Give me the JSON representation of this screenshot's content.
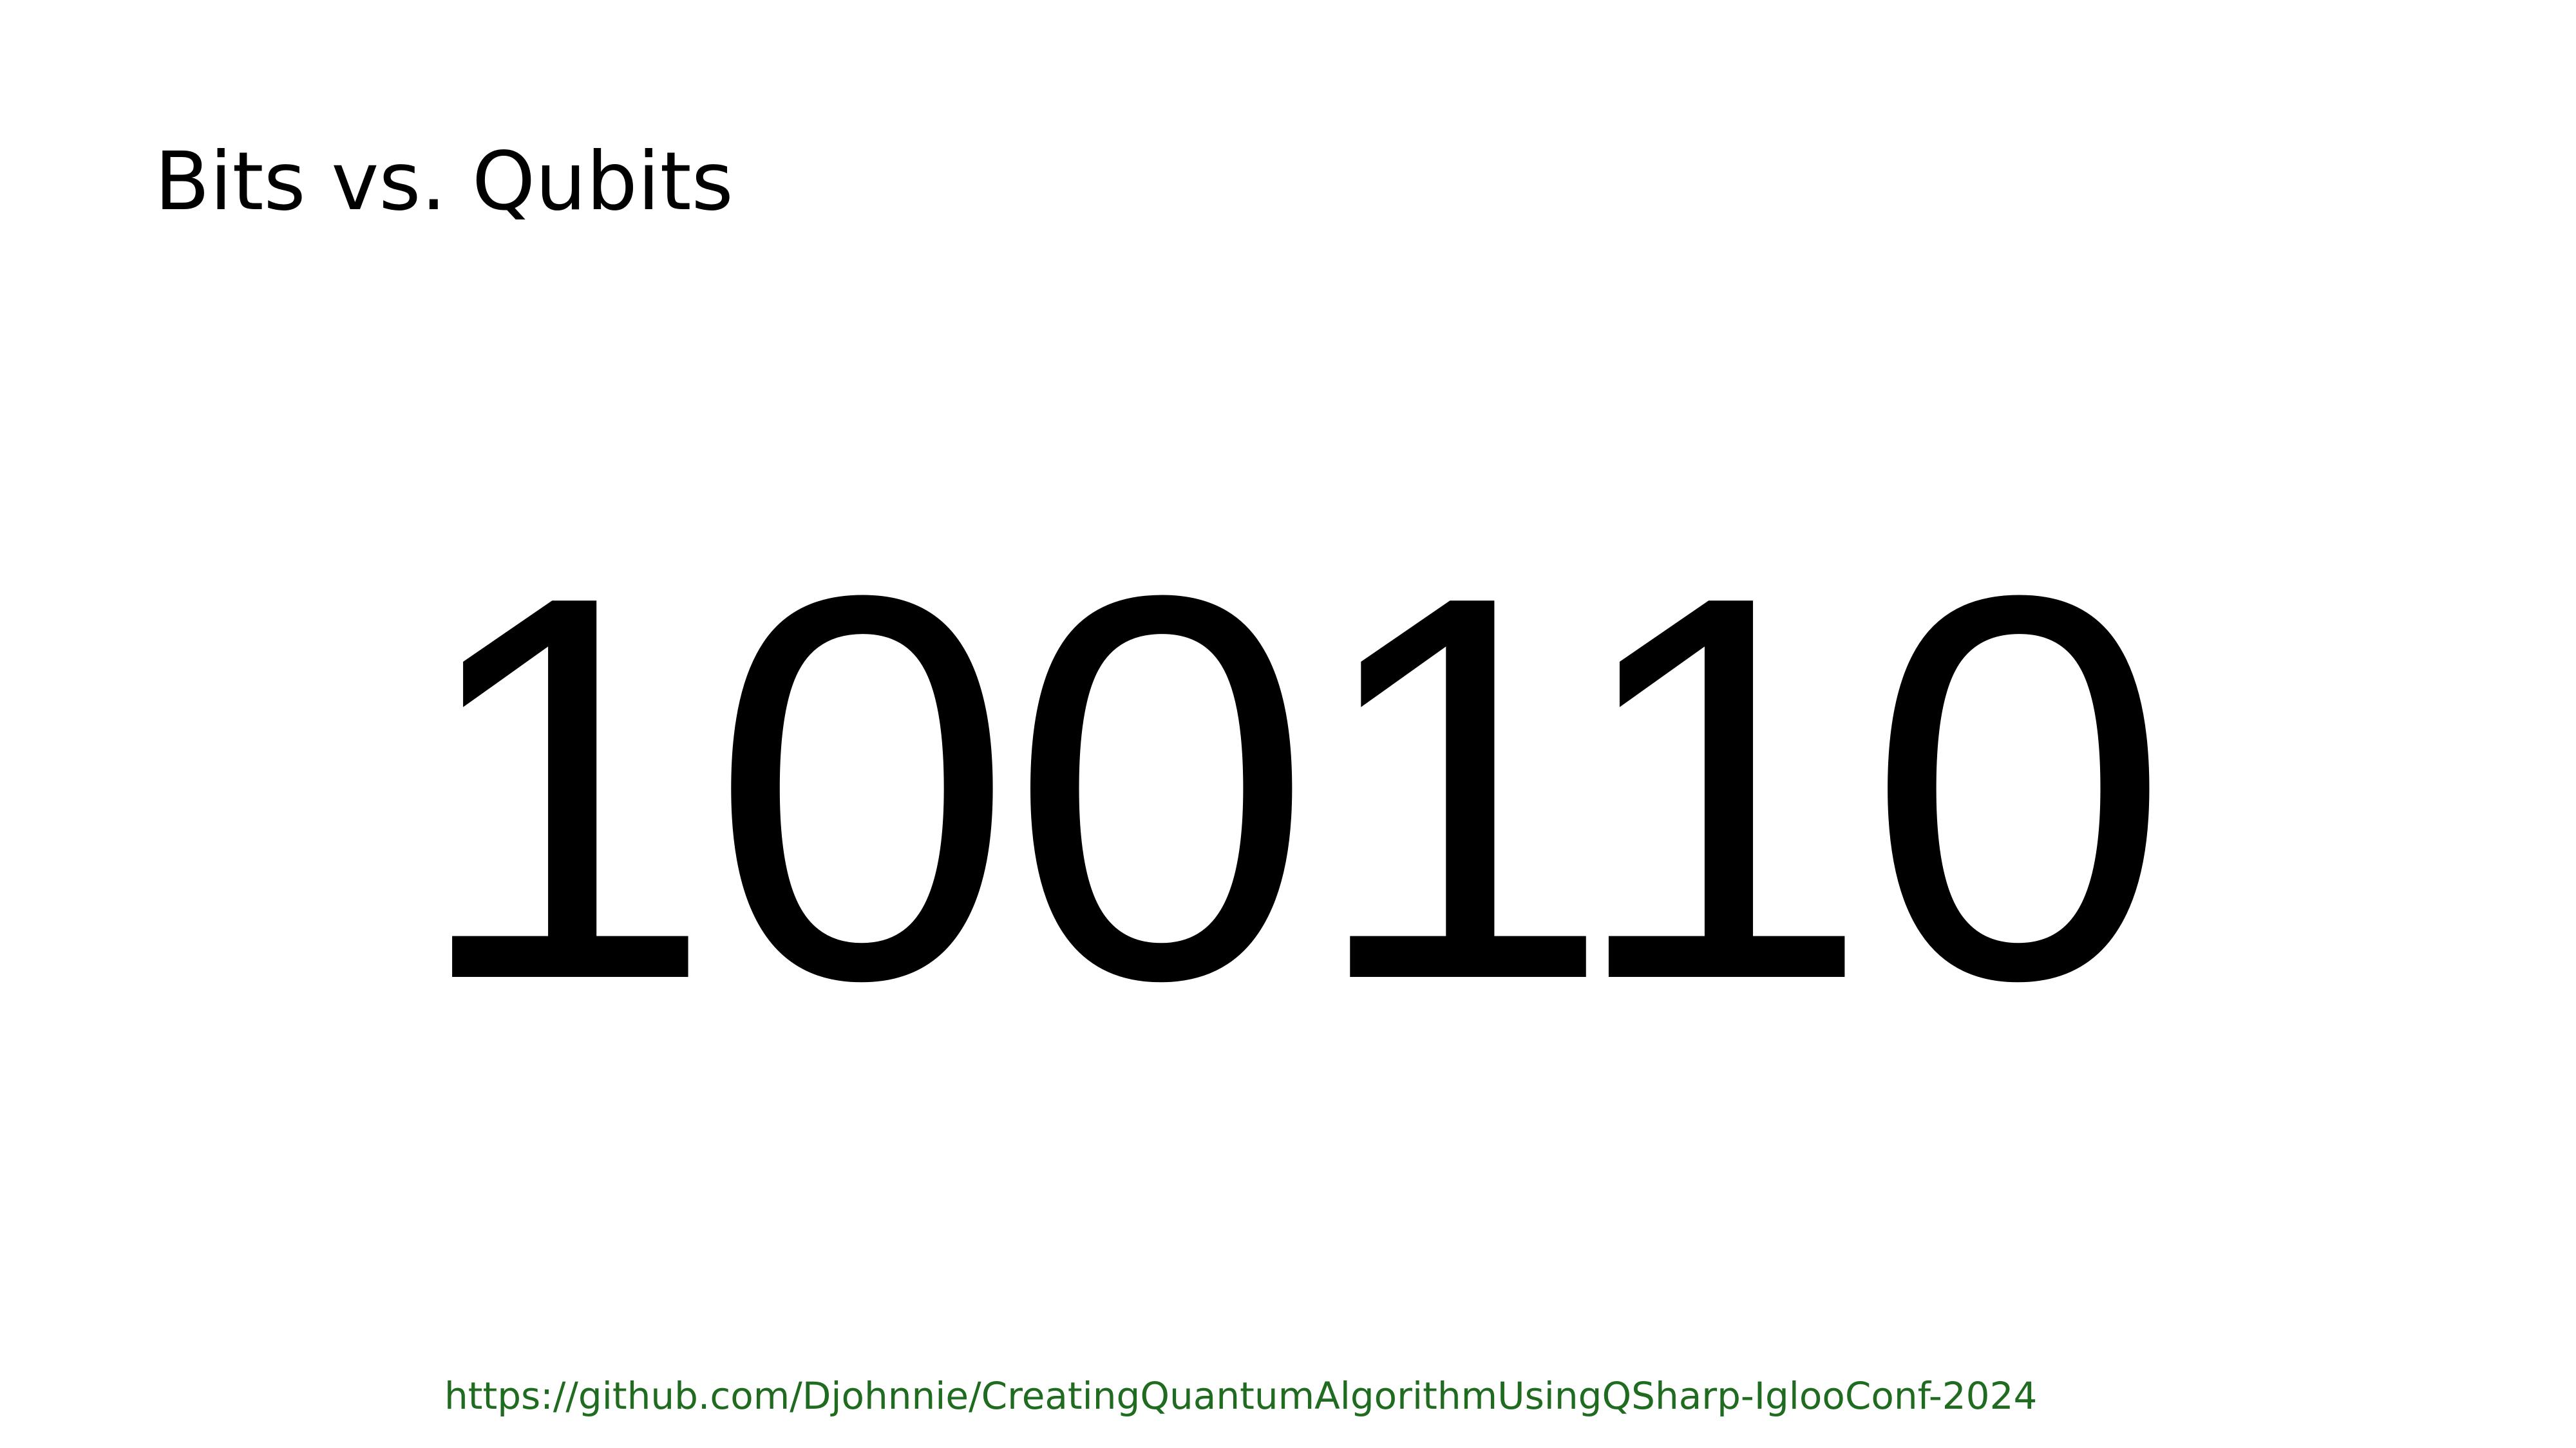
{
  "slide": {
    "title": "Bits vs. Qubits",
    "bits": "100110",
    "link": {
      "text": "https://github.com/Djohnnie/CreatingQuantumAlgorithmUsingQSharp-IglooConf-2024",
      "color": "#1f6b1f"
    }
  }
}
